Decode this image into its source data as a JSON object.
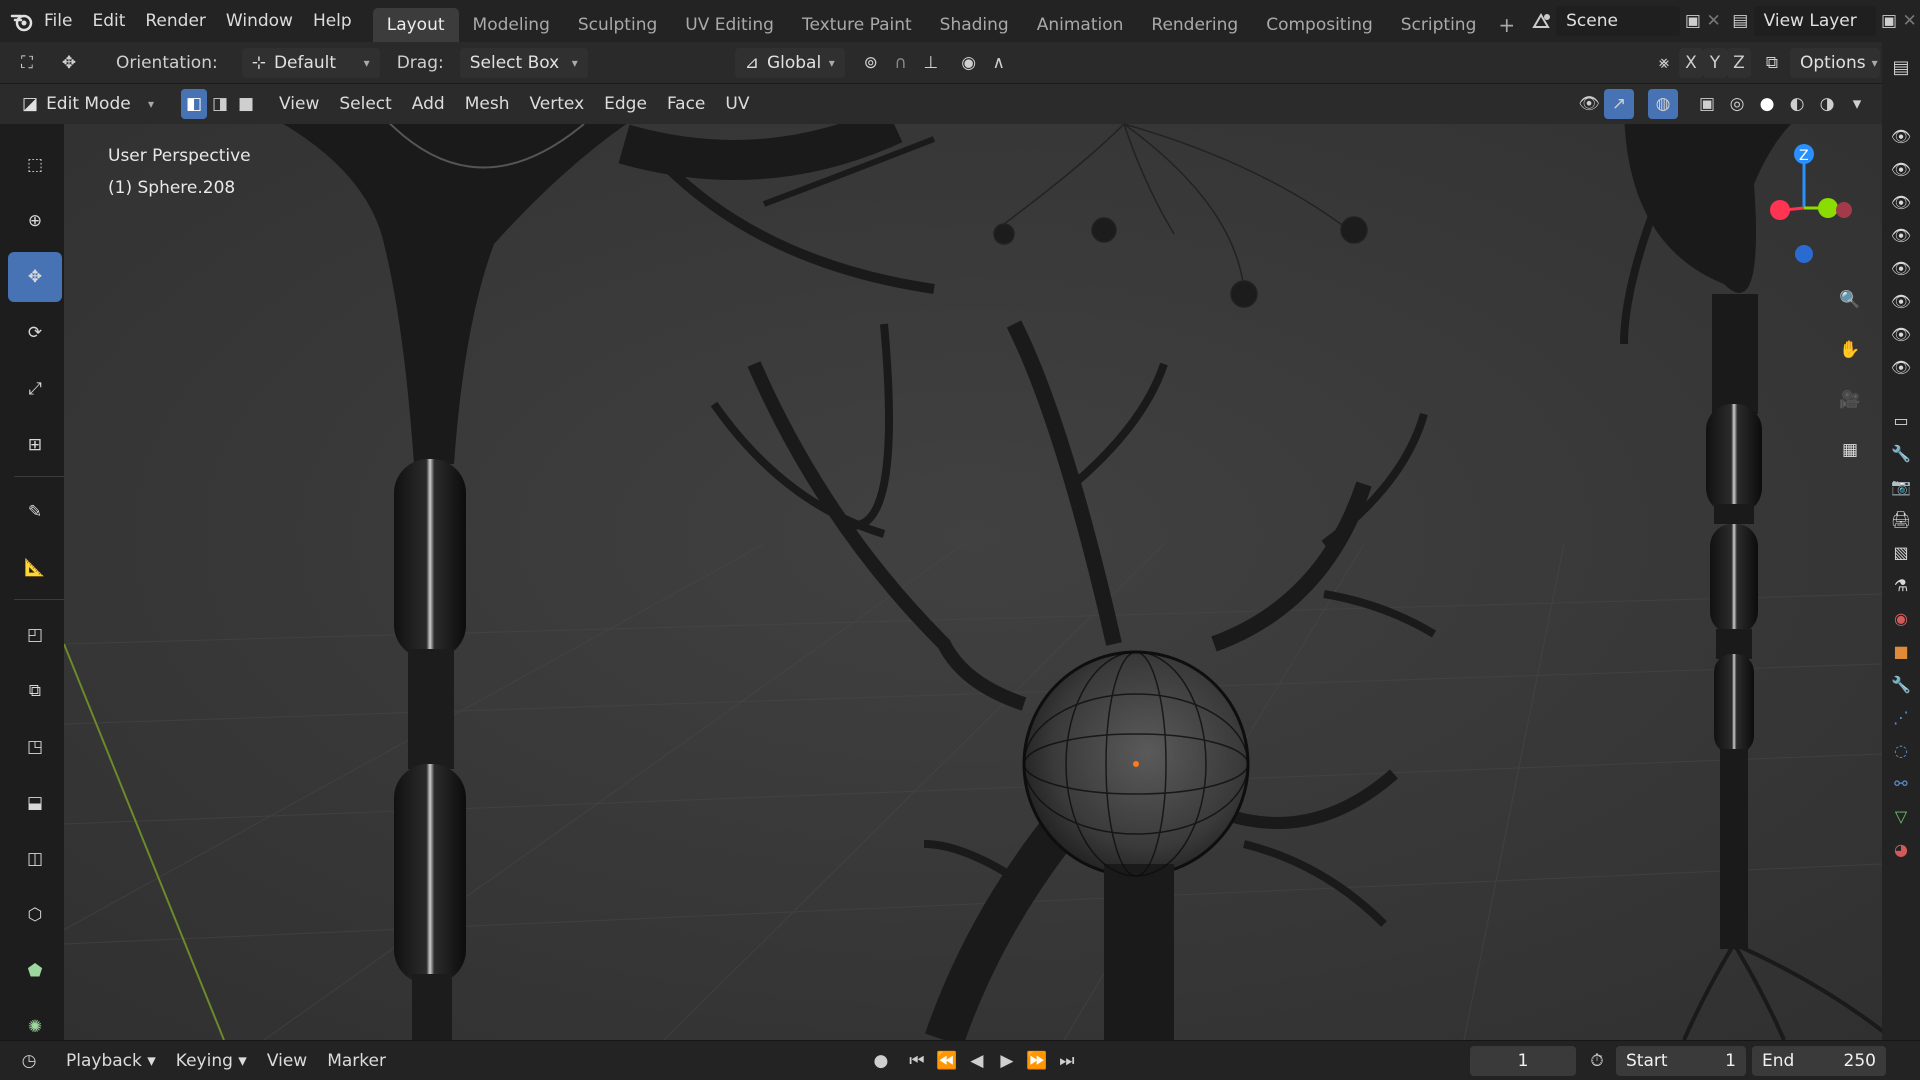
{
  "topbar": {
    "menus": [
      "File",
      "Edit",
      "Render",
      "Window",
      "Help"
    ],
    "workspaces": [
      "Layout",
      "Modeling",
      "Sculpting",
      "UV Editing",
      "Texture Paint",
      "Shading",
      "Animation",
      "Rendering",
      "Compositing",
      "Scripting"
    ],
    "active_workspace": "Layout",
    "add_tab": "+",
    "scene": "Scene",
    "view_layer": "View Layer"
  },
  "tool_header": {
    "orientation_label": "Orientation:",
    "orientation_value": "Default",
    "drag_label": "Drag:",
    "drag_value": "Select Box",
    "transform_orientation": "Global",
    "axes": [
      "X",
      "Y",
      "Z"
    ],
    "options": "Options"
  },
  "editor_header": {
    "mode": "Edit Mode",
    "menus": [
      "View",
      "Select",
      "Add",
      "Mesh",
      "Vertex",
      "Edge",
      "Face",
      "UV"
    ]
  },
  "viewport": {
    "perspective": "User Perspective",
    "object": "(1) Sphere.208",
    "gizmo": {
      "z": "Z",
      "colors": {
        "x": "#ff3352",
        "y": "#8bdc00",
        "z": "#2890ff"
      }
    }
  },
  "tools": [
    "cursor-select",
    "3d-cursor",
    "move",
    "rotate",
    "scale",
    "transform",
    "annotate",
    "measure",
    "add-cube",
    "extrude",
    "inset",
    "bevel",
    "loop-cut",
    "knife",
    "poly-build",
    "spin"
  ],
  "timeline": {
    "menus": [
      "Playback",
      "Keying",
      "View",
      "Marker"
    ],
    "current_frame": "1",
    "start_label": "Start",
    "start": "1",
    "end_label": "End",
    "end": "250"
  },
  "colors": {
    "accent": "#4772b3",
    "header": "#2b2b2b",
    "viewport_bg": "#3b3b3b"
  }
}
